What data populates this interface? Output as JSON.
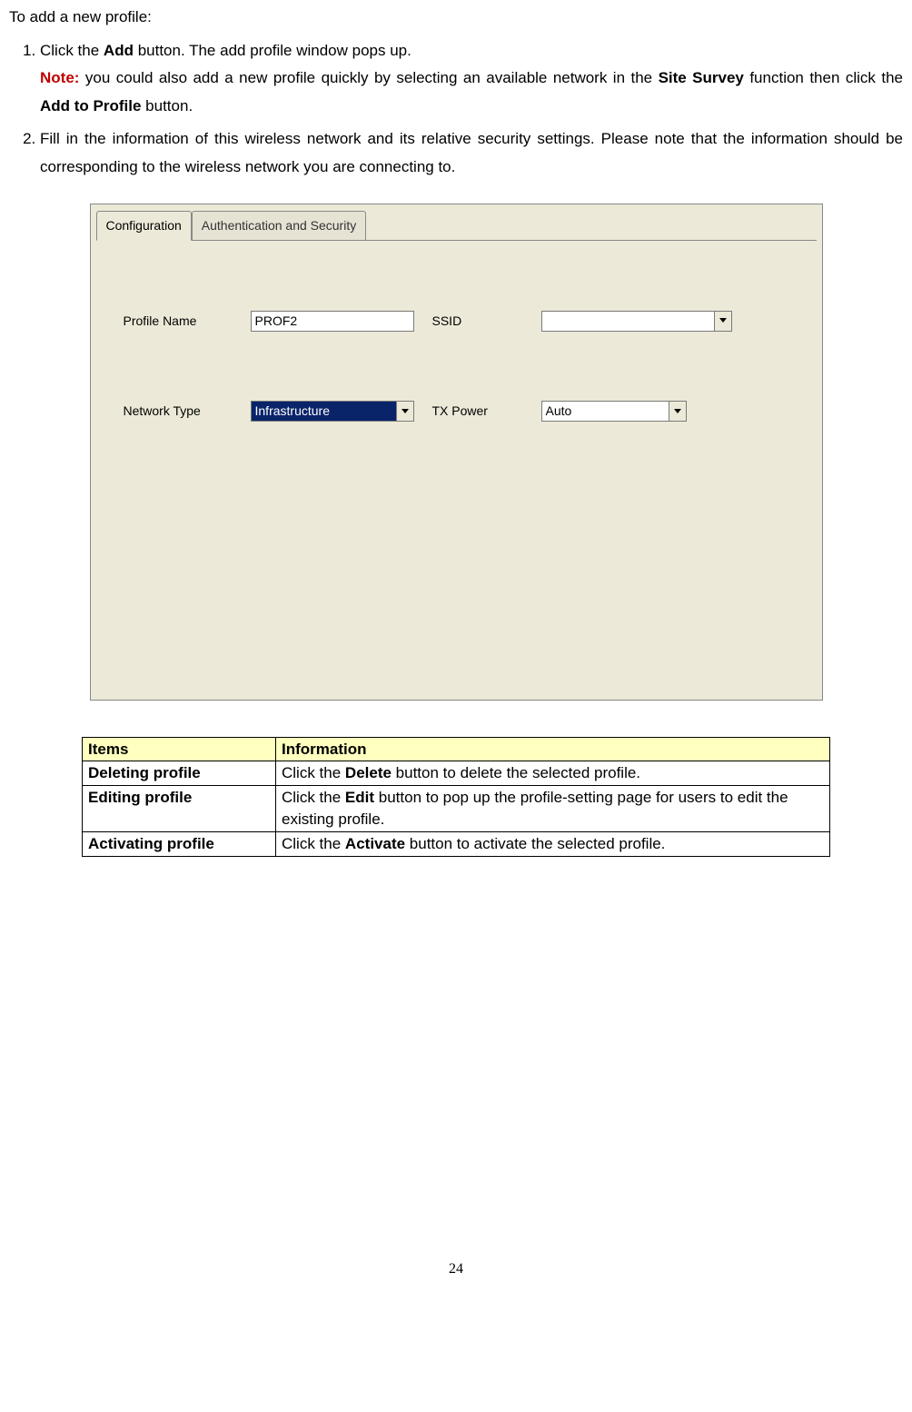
{
  "text": {
    "intro": "To add a new profile:",
    "step1_a": "Click the ",
    "step1_add": "Add",
    "step1_b": " button. The add profile window pops up.",
    "note_label": "Note:",
    "note_a": " you could also add a new profile quickly by selecting an available network in the ",
    "note_site_survey": "Site Survey",
    "note_b": " function then click the ",
    "note_add_to_profile": "Add to Profile",
    "note_c": " button.",
    "step2": "Fill in the information of this wireless network and its relative security settings. Please note that the information should be corresponding to the wireless network you are connecting to."
  },
  "dialog": {
    "tab_configuration": "Configuration",
    "tab_auth": "Authentication and Security",
    "label_profile_name": "Profile Name",
    "value_profile_name": "PROF2",
    "label_ssid": "SSID",
    "value_ssid": "",
    "label_network_type": "Network Type",
    "value_network_type": "Infrastructure",
    "label_tx_power": "TX Power",
    "value_tx_power": "Auto"
  },
  "table": {
    "header_items": "Items",
    "header_information": "Information",
    "rows": [
      {
        "item": "Deleting profile",
        "info_a": "Click the ",
        "info_bold": "Delete",
        "info_b": " button to delete the selected profile."
      },
      {
        "item": "Editing profile",
        "info_a": "Click the ",
        "info_bold": "Edit",
        "info_b": " button to pop up the profile-setting page for users to edit the existing profile."
      },
      {
        "item": "Activating profile",
        "info_a": "Click the ",
        "info_bold": "Activate",
        "info_b": " button to activate the selected profile."
      }
    ]
  },
  "page_number": "24"
}
